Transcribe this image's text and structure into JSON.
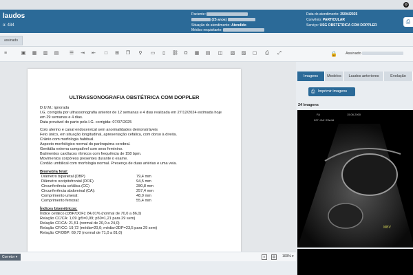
{
  "app": {
    "title": "laudos",
    "protocol": "o: 434"
  },
  "header": {
    "patient_label": "Paciente:",
    "age": "(25 anos)",
    "status_label": "Situação do atendimento:",
    "status_value": "Atendido",
    "doctor_label": "Médico requisitante:",
    "date_label": "Data do atendimento:",
    "date_value": "25/04/2025",
    "agreement_label": "Convênio:",
    "agreement_value": "PARTICULAR",
    "service_label": "Serviço:",
    "service_value": "USG OBSTETRICA COM DOPPLER"
  },
  "tabs": {
    "assinado": "assinado"
  },
  "signed": {
    "label": "Assinado"
  },
  "right_tabs": [
    "Imagens",
    "Modelos",
    "Laudos anteriores",
    "Evolução"
  ],
  "images": {
    "print_button": "Imprimir imagens",
    "count": "24 Imagens",
    "caption_date": "15.06.2000",
    "caption_text": "227 -GA~29w4d",
    "mbv": "MBV"
  },
  "bottom": {
    "corretor": "Corretor",
    "zoom": "100%"
  },
  "document": {
    "title": "ULTRASSONOGRAFIA OBSTÉTRICA COM DOPPLER",
    "dum": "D.U.M.: ignorada",
    "ig1": "I.G. corrigida por ultrassonografia anterior de 12 semanas e 4 dias realizada em 27/12/2024 estimada hoje",
    "ig2": "em 29 semanas e 4 dias.",
    "dpp": "Data provável do parto pela I.G. corrigida: 07/07/2025",
    "findings": [
      "Colo uterino e canal endocervical sem anormalidades demonstráveis",
      "Feto único, em situação longitudinal, apresentação cefálica, com dorso à direita.",
      "Crânio com morfologia habitual.",
      "Aspecto morfológico normal do parênquima cerebral.",
      "Genitália externa compatível com sexo feminino.",
      "Batimentos cardíacos rítmicos com frequência de 158 bpm.",
      "Movimentos corpóreos presentes durante o exame.",
      "Cordão umbilical com morfologia normal. Presença de duas artérias e uma veia."
    ],
    "biometry_title": "Biometria fetal:",
    "biometry": [
      {
        "label": "Diâmetro biparietal (DBP)",
        "value": "79,4 mm"
      },
      {
        "label": "Diâmetro occipitofrontal (DOF)",
        "value": "94,5 mm"
      },
      {
        "label": "Circunferência cefálica (CC)",
        "value": "280,8 mm"
      },
      {
        "label": "Circunferência abdominal (CA):",
        "value": "257,4 mm"
      },
      {
        "label": "Comprimento umeral:",
        "value": "48,0 mm"
      },
      {
        "label": "Comprimento femoral:",
        "value": "55,4 mm"
      }
    ],
    "indices_title": "Índices biométricos:",
    "indices": [
      "Índice cefálico (DBP/DOF): 84,01% (normal de 70,0 a 86,0)",
      "Relação CC/CA: 1,09 (p5=0,99; p50=1,21 para 29 sem)",
      "Relação CF/CA: 21,51 (normal de 20,0 a 24,0)",
      "Relação CF/CC: 19,72 (média=20,0; média+2DP=23,5 para 29 sem)",
      "Relação CF/DBP: 69,72 (normal de 71,0 a 81,0)"
    ]
  }
}
